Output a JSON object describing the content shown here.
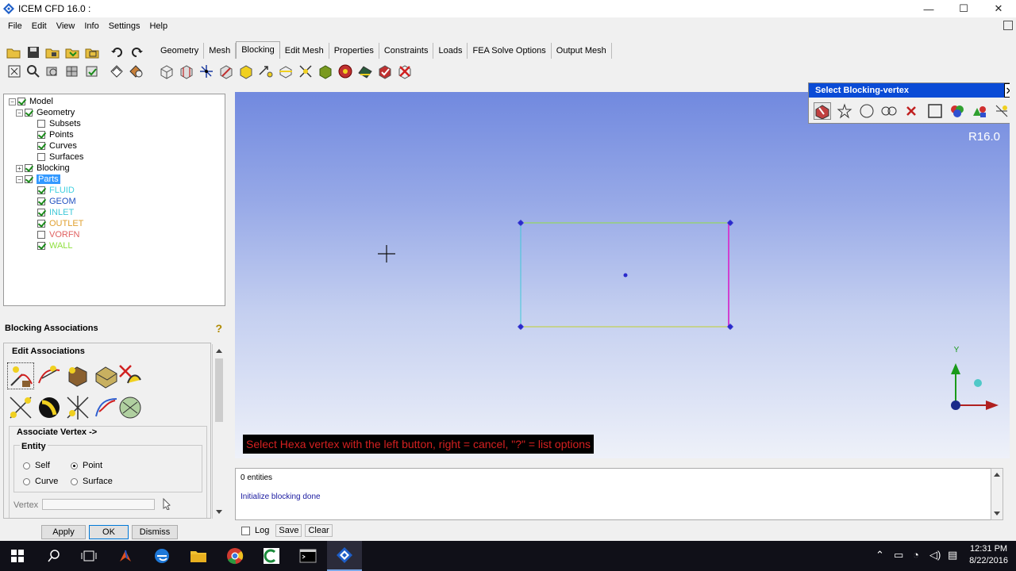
{
  "window": {
    "title": "ICEM CFD 16.0 :",
    "minimize": "—",
    "maximize": "☐",
    "close": "✕"
  },
  "menubar": [
    "File",
    "Edit",
    "View",
    "Info",
    "Settings",
    "Help"
  ],
  "tabs": [
    {
      "label": "Geometry",
      "active": false
    },
    {
      "label": "Mesh",
      "active": false
    },
    {
      "label": "Blocking",
      "active": true
    },
    {
      "label": "Edit Mesh",
      "active": false
    },
    {
      "label": "Properties",
      "active": false
    },
    {
      "label": "Constraints",
      "active": false
    },
    {
      "label": "Loads",
      "active": false
    },
    {
      "label": "FEA Solve Options",
      "active": false
    },
    {
      "label": "Output Mesh",
      "active": false
    }
  ],
  "tree": {
    "model": "Model",
    "geometry": "Geometry",
    "subsets": "Subsets",
    "points": "Points",
    "curves": "Curves",
    "surfaces": "Surfaces",
    "blocking": "Blocking",
    "parts": "Parts",
    "part_items": [
      {
        "label": "FLUID",
        "color": "#40d0e0",
        "checked": true
      },
      {
        "label": "GEOM",
        "color": "#2050c0",
        "checked": true
      },
      {
        "label": "INLET",
        "color": "#40c8d8",
        "checked": true
      },
      {
        "label": "OUTLET",
        "color": "#e0a030",
        "checked": true
      },
      {
        "label": "VORFN",
        "color": "#e06060",
        "checked": false
      },
      {
        "label": "WALL",
        "color": "#90e040",
        "checked": true
      }
    ]
  },
  "assoc": {
    "title": "Blocking Associations",
    "help": "?",
    "edit_title": "Edit Associations",
    "vertex_group": "Associate Vertex ->",
    "entity_group": "Entity",
    "radio_self": "Self",
    "radio_point": "Point",
    "radio_curve": "Curve",
    "radio_surface": "Surface",
    "vertex_label": "Vertex",
    "vertex_value": "",
    "selected_entity": "Point"
  },
  "buttons": {
    "apply": "Apply",
    "ok": "OK",
    "dismiss": "Dismiss"
  },
  "viewport": {
    "version": "R16.0",
    "status": "Select Hexa vertex with the left button, right = cancel, \"?\" = list options",
    "axis_y": "Y"
  },
  "select_vertex": {
    "title": "Select Blocking-vertex",
    "close": "✕"
  },
  "messages": {
    "line1": "0 entities",
    "line2": "Initialize blocking done"
  },
  "msg_controls": {
    "log": "Log",
    "save": "Save",
    "clear": "Clear"
  },
  "taskbar": {
    "time": "12:31 PM",
    "date": "8/22/2016"
  },
  "colors": {
    "accent": "#0a4bd6",
    "status_red": "#d42020",
    "inlet_edge": "#40c8d8",
    "wall_edge": "#90e040",
    "outlet_edge": "#d040d0"
  }
}
